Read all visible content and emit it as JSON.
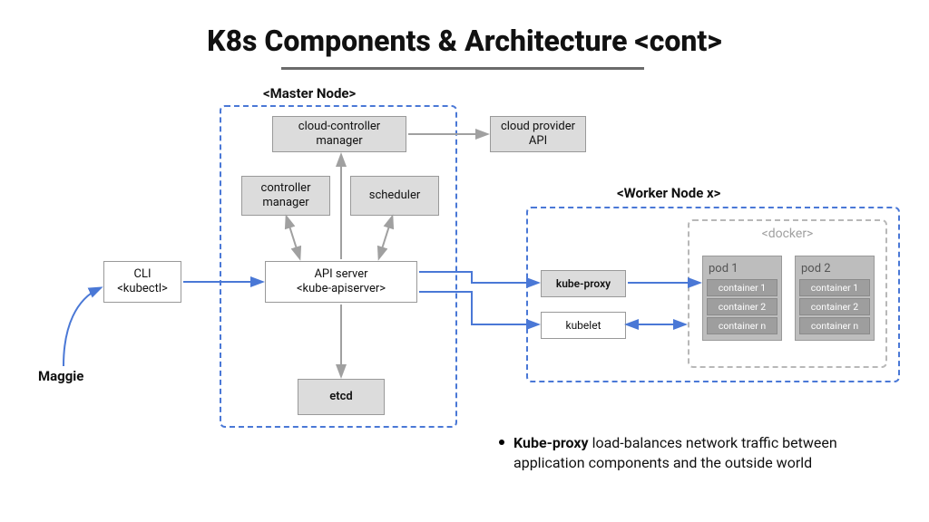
{
  "title": "K8s Components & Architecture <cont>",
  "user": "Maggie",
  "master": {
    "label": "<Master Node>",
    "cloud_controller": "cloud-controller manager",
    "controller_manager": "controller manager",
    "scheduler": "scheduler",
    "api_server": "API server\n<kube-apiserver>",
    "etcd": "etcd"
  },
  "cloud_api": "cloud provider API",
  "cli": "CLI\n<kubectl>",
  "worker": {
    "label": "<Worker Node x>",
    "kube_proxy": "kube-proxy",
    "kubelet": "kubelet",
    "docker": {
      "label": "<docker>",
      "pods": [
        {
          "title": "pod 1",
          "containers": [
            "container 1",
            "container 2",
            "container n"
          ]
        },
        {
          "title": "pod 2",
          "containers": [
            "container 1",
            "container 2",
            "container n"
          ]
        }
      ]
    }
  },
  "bullet": {
    "bold": "Kube-proxy",
    "rest": " load-balances network traffic between application components and the outside world"
  }
}
